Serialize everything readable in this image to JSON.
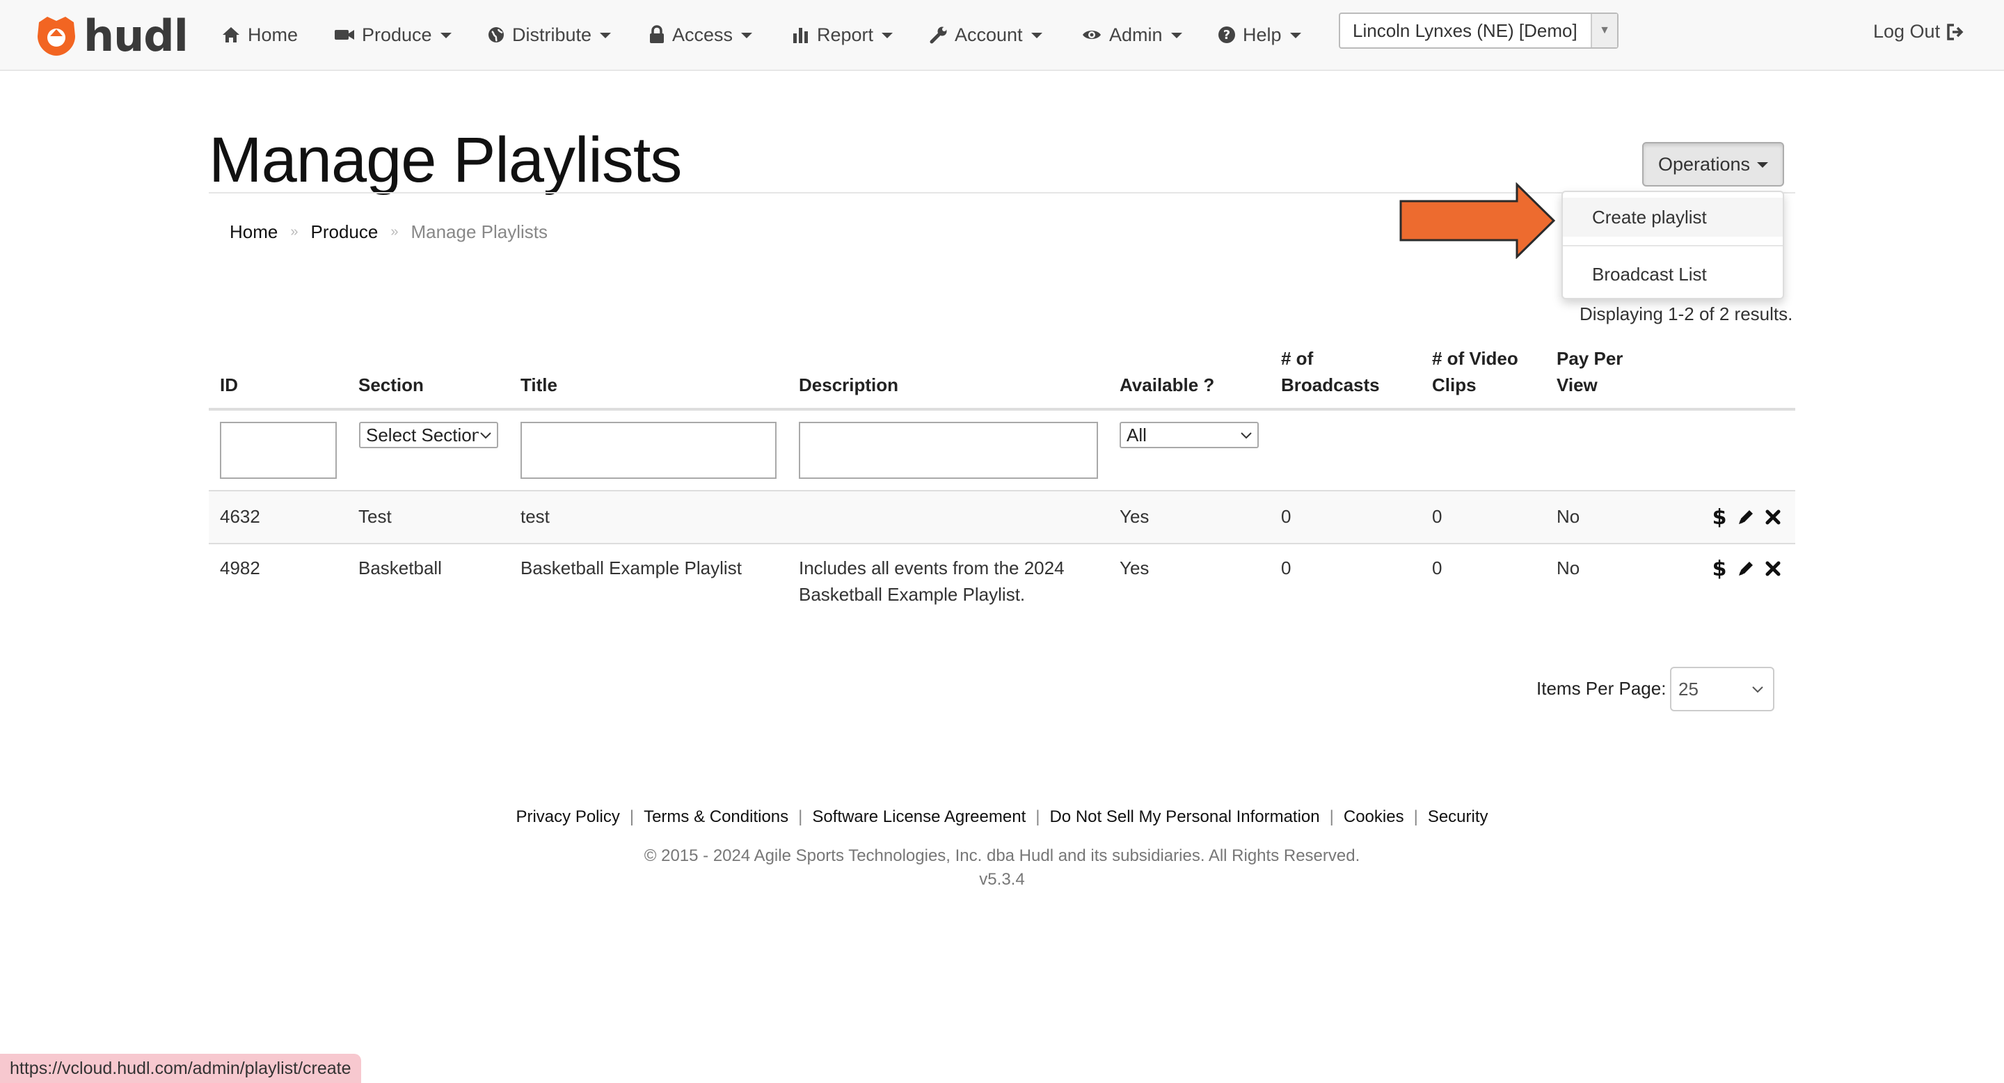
{
  "brand": {
    "name": "hudl",
    "accent": "#f26522"
  },
  "nav": {
    "home": "Home",
    "produce": "Produce",
    "distribute": "Distribute",
    "access": "Access",
    "report": "Report",
    "account": "Account",
    "admin": "Admin",
    "help": "Help",
    "org_selected": "Lincoln Lynxes (NE) [Demo]",
    "logout": "Log Out"
  },
  "page": {
    "title": "Manage Playlists",
    "operations_label": "Operations",
    "operations_menu": [
      "Create playlist",
      "Broadcast List"
    ],
    "breadcrumb": [
      "Home",
      "Produce",
      "Manage Playlists"
    ],
    "summary": "Displaying 1-2 of 2 results."
  },
  "table": {
    "headers": {
      "id": "ID",
      "section": "Section",
      "title": "Title",
      "description": "Description",
      "available": "Available ?",
      "broadcasts_1": "# of",
      "broadcasts_2": "Broadcasts",
      "clips_1": "# of Video",
      "clips_2": "Clips",
      "ppv_1": "Pay Per",
      "ppv_2": "View"
    },
    "filters": {
      "section_placeholder": "Select Section",
      "available_value": "All"
    },
    "rows": [
      {
        "id": "4632",
        "section": "Test",
        "title": "test",
        "description_1": "",
        "description_2": "",
        "available": "Yes",
        "broadcasts": "0",
        "clips": "0",
        "ppv": "No"
      },
      {
        "id": "4982",
        "section": "Basketball",
        "title": "Basketball Example Playlist",
        "description_1": "Includes all events from the 2024",
        "description_2": "Basketball Example Playlist.",
        "available": "Yes",
        "broadcasts": "0",
        "clips": "0",
        "ppv": "No"
      }
    ],
    "action_icons": [
      "dollar-icon",
      "pencil-icon",
      "close-icon"
    ]
  },
  "pagination": {
    "label": "Items Per Page:",
    "value": "25"
  },
  "footer": {
    "links": [
      "Privacy Policy",
      "Terms & Conditions",
      "Software License Agreement",
      "Do Not Sell My Personal Information",
      "Cookies",
      "Security"
    ],
    "copyright": "© 2015 - 2024 Agile Sports Technologies, Inc. dba Hudl and its subsidiaries. All Rights Reserved.",
    "version": "v5.3.4"
  },
  "status_url": "https://vcloud.hudl.com/admin/playlist/create"
}
